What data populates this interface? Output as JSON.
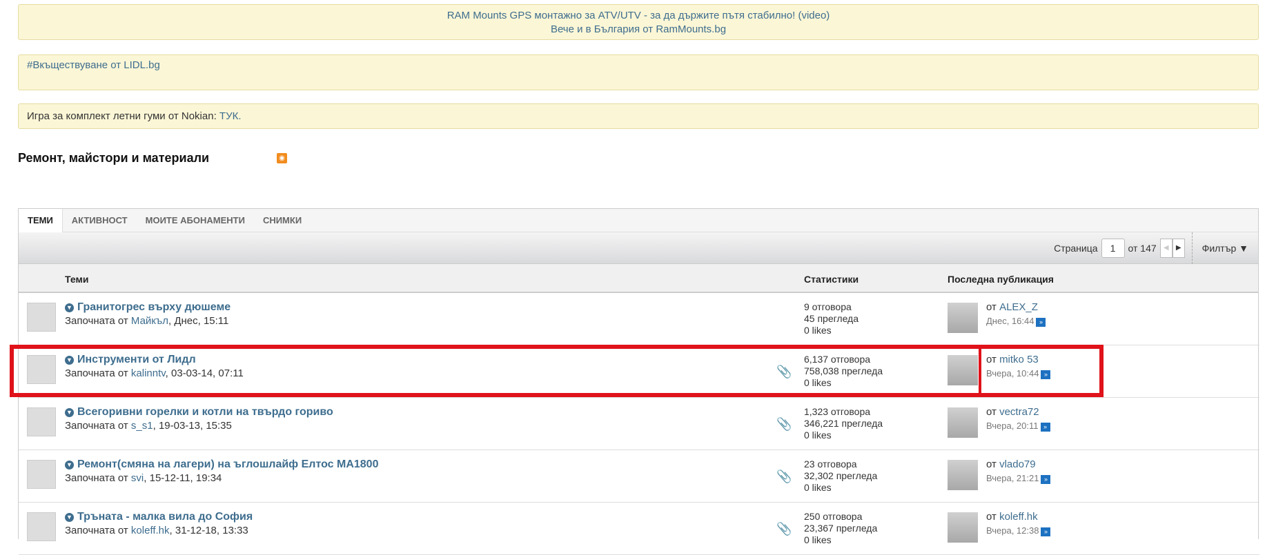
{
  "banners": {
    "ram_line1": "RAM Mounts GPS монтажно за ATV/UTV - за да държите пътя стабилно! (video)",
    "ram_line2": "Вече и в България от RamMounts.bg",
    "lidl": "#Вкъществуване от LIDL.bg",
    "nokian_text": "Игра за комплект летни гуми от Nokian: ",
    "nokian_link": "ТУК."
  },
  "forum_title": "Ремонт, майстори и материали",
  "tabs": [
    "ТЕМИ",
    "АКТИВНОСТ",
    "МОИТЕ АБОНАМЕНТИ",
    "СНИМКИ"
  ],
  "toolbar": {
    "page_label": "Страница",
    "page": "1",
    "of": "от 147",
    "filter": "Филтър ▼"
  },
  "columns": {
    "topics": "Теми",
    "stats": "Статистики",
    "last": "Последна публикация"
  },
  "started_by": "Започната от ",
  "by": "от ",
  "threads": [
    {
      "title": "Гранитогрес върху дюшеме",
      "author": "Майкъл",
      "date": ", Днес, 15:11",
      "replies": "9 отговора",
      "views": "45 прегледа",
      "likes": "0 likes",
      "last_user": "ALEX_Z",
      "last_time": "Днес, 16:44",
      "attach": false
    },
    {
      "title": "Инструменти от Лидл",
      "author": "kalinntv",
      "date": ", 03-03-14, 07:11",
      "replies": "6,137 отговора",
      "views": "758,038 прегледа",
      "likes": "0 likes",
      "last_user": "mitko 53",
      "last_time": "Вчера, 10:44",
      "attach": true
    },
    {
      "title": "Всегоривни горелки и котли на твърдо гориво",
      "author": "s_s1",
      "date": ", 19-03-13, 15:35",
      "replies": "1,323 отговора",
      "views": "346,221 прегледа",
      "likes": "0 likes",
      "last_user": "vectra72",
      "last_time": "Вчера, 20:11",
      "attach": true
    },
    {
      "title": "Ремонт(смяна на лагери) на ъглошлайф Елтос МА1800",
      "author": "svi",
      "date": ", 15-12-11, 19:34",
      "replies": "23 отговора",
      "views": "32,302 прегледа",
      "likes": "0 likes",
      "last_user": "vlado79",
      "last_time": "Вчера, 21:21",
      "attach": true
    },
    {
      "title": "Тръната - малка вила до София",
      "author": "koleff.hk",
      "date": ", 31-12-18, 13:33",
      "replies": "250 отговора",
      "views": "23,367 прегледа",
      "likes": "0 likes",
      "last_user": "koleff.hk",
      "last_time": "Вчера, 12:38",
      "attach": true
    }
  ]
}
